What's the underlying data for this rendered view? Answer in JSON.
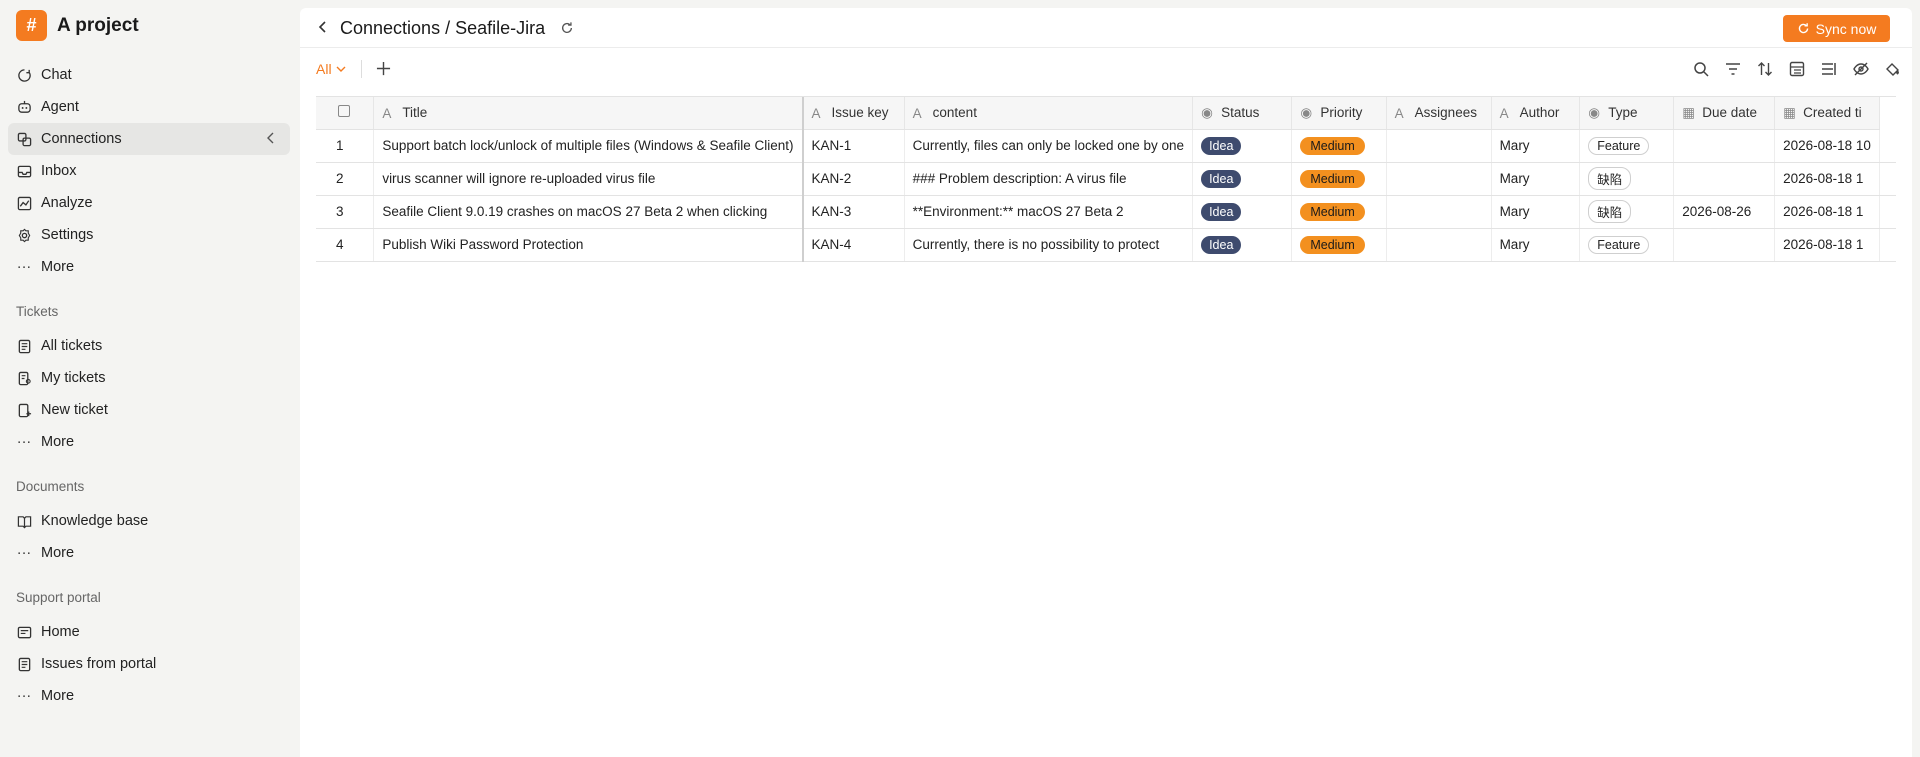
{
  "app": {
    "name": "A project",
    "logo_glyph": "#",
    "brand_color": "#f47b20"
  },
  "sidebar": {
    "primary": [
      {
        "label": "Chat",
        "icon": "chat-icon"
      },
      {
        "label": "Agent",
        "icon": "agent-icon"
      },
      {
        "label": "Connections",
        "icon": "connections-icon",
        "active": true
      },
      {
        "label": "Inbox",
        "icon": "inbox-icon"
      },
      {
        "label": "Analyze",
        "icon": "analyze-icon"
      },
      {
        "label": "Settings",
        "icon": "gear-icon"
      },
      {
        "label": "More",
        "icon": "more-icon"
      }
    ],
    "tickets_label": "Tickets",
    "tickets": [
      {
        "label": "All tickets",
        "icon": "tickets-icon"
      },
      {
        "label": "My tickets",
        "icon": "my-tickets-icon"
      },
      {
        "label": "New ticket",
        "icon": "new-ticket-icon"
      },
      {
        "label": "More",
        "icon": "more-icon"
      }
    ],
    "documents_label": "Documents",
    "documents": [
      {
        "label": "Knowledge base",
        "icon": "book-icon"
      },
      {
        "label": "More",
        "icon": "more-icon"
      }
    ],
    "portal_label": "Support portal",
    "portal": [
      {
        "label": "Home",
        "icon": "home-icon"
      },
      {
        "label": "Issues from portal",
        "icon": "issues-icon"
      },
      {
        "label": "More",
        "icon": "more-icon"
      }
    ]
  },
  "header": {
    "breadcrumb": "Connections / Seafile-Jira",
    "sync_label": "Sync now"
  },
  "viewbar": {
    "view_label": "All"
  },
  "table": {
    "columns": [
      "Title",
      "Issue key",
      "content",
      "Status",
      "Priority",
      "Assignees",
      "Author",
      "Type",
      "Due date",
      "Created ti"
    ],
    "rows": [
      {
        "index": "1",
        "title": "Support batch lock/unlock of multiple files (Windows & Seafile Client)",
        "key": "KAN-1",
        "content": "Currently, files can only be locked one by one",
        "status": "Idea",
        "priority": "Medium",
        "assignees": "",
        "author": "Mary",
        "type": "Feature",
        "due": "",
        "created": "2026-08-18 10"
      },
      {
        "index": "2",
        "title": "virus scanner will ignore re-uploaded virus file",
        "key": "KAN-2",
        "content": "### Problem description: A virus file",
        "status": "Idea",
        "priority": "Medium",
        "assignees": "",
        "author": "Mary",
        "type": "缺陷",
        "due": "",
        "created": "2026-08-18 1"
      },
      {
        "index": "3",
        "title": "Seafile Client 9.0.19 crashes on macOS 27 Beta 2 when clicking",
        "key": "KAN-3",
        "content": "**Environment:** macOS 27 Beta 2",
        "status": "Idea",
        "priority": "Medium",
        "assignees": "",
        "author": "Mary",
        "type": "缺陷",
        "due": "2026-08-26",
        "created": "2026-08-18 1"
      },
      {
        "index": "4",
        "title": "Publish Wiki Password Protection",
        "key": "KAN-4",
        "content": "Currently, there is no possibility to protect",
        "status": "Idea",
        "priority": "Medium",
        "assignees": "",
        "author": "Mary",
        "type": "Feature",
        "due": "",
        "created": "2026-08-18 1"
      }
    ]
  },
  "colors": {
    "accent": "#f47b20",
    "status_idea": "#3e4b6e",
    "priority_medium": "#f3901f"
  }
}
